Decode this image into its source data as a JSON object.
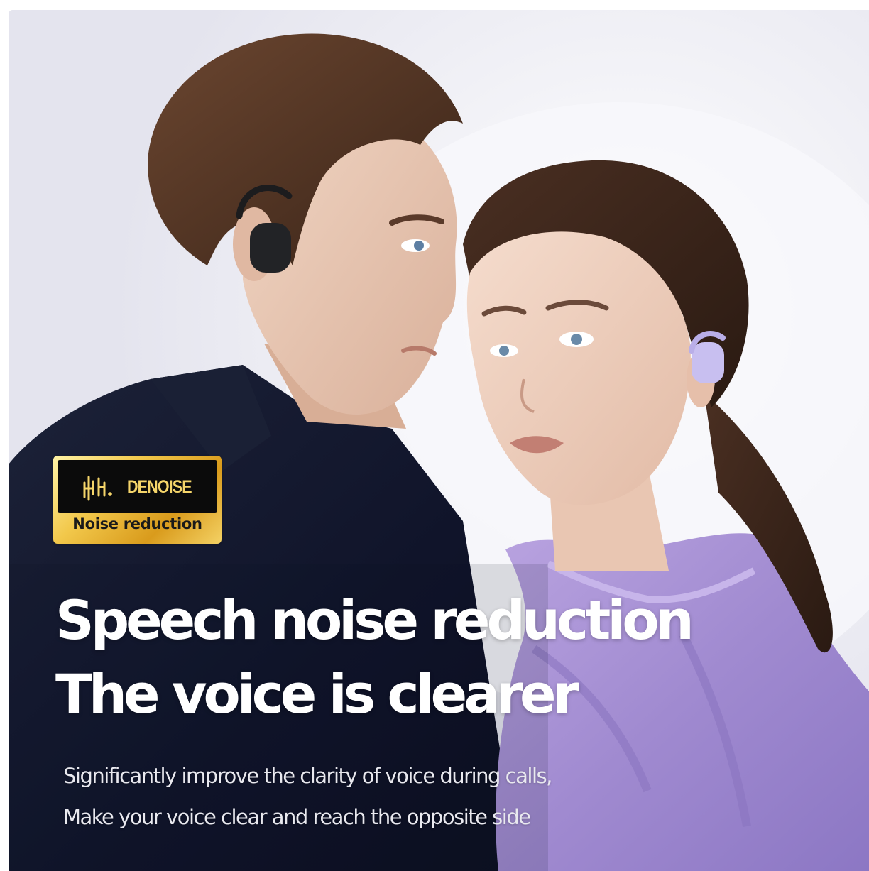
{
  "badge": {
    "icon": "sound-wave-icon",
    "brand": "DENOISE",
    "caption": "Noise reduction"
  },
  "headline": {
    "line1": "Speech noise reduction",
    "line2": "The voice is clearer"
  },
  "subtext": {
    "line1": "Significantly improve the clarity of voice during calls,",
    "line2": "Make your voice clear and reach the opposite side"
  },
  "colors": {
    "badge_gold": "#e8b83a",
    "badge_black": "#0b0b0b",
    "headline": "#ffffff",
    "jacket": "#141a2c",
    "blouse": "#a58fd0"
  }
}
